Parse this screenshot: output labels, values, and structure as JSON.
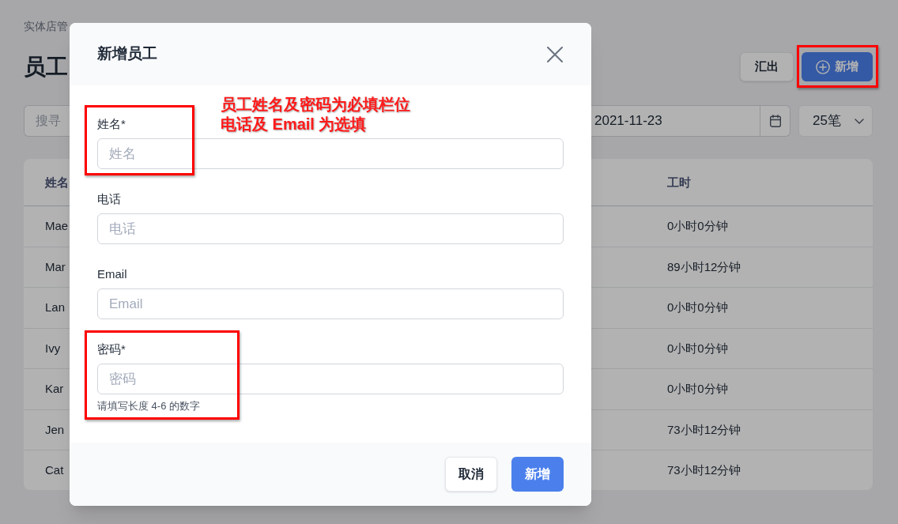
{
  "breadcrumb": [
    "实体店管"
  ],
  "page": {
    "title": "员工",
    "actions": [
      {
        "label": "汇出",
        "kind": "secondary",
        "highlighted": false
      },
      {
        "label": "新增",
        "kind": "primary",
        "highlighted": true
      }
    ]
  },
  "filters": {
    "search": {
      "placeholder": "搜寻"
    },
    "date": {
      "value": "2021-11-23"
    },
    "page_size": {
      "value": "25笔"
    }
  },
  "table": {
    "columns": [
      "姓名",
      "工时"
    ],
    "rows": [
      [
        "Mae",
        "0小时0分钟"
      ],
      [
        "Mar",
        "89小时12分钟"
      ],
      [
        "Lan",
        "0小时0分钟"
      ],
      [
        "Ivy",
        "0小时0分钟"
      ],
      [
        "Kar",
        "0小时0分钟"
      ],
      [
        "Jen",
        "73小时12分钟"
      ],
      [
        "Cat",
        "73小时12分钟"
      ]
    ]
  },
  "dialog": {
    "title": "新增员工",
    "annotation": [
      "员工姓名及密码为必填栏位",
      "电话及 Email 为选填"
    ],
    "fields": [
      {
        "label": "姓名*",
        "placeholder": "姓名",
        "highlighted": true
      },
      {
        "label": "电话",
        "placeholder": "电话",
        "highlighted": false
      },
      {
        "label": "Email",
        "placeholder": "Email",
        "highlighted": false
      },
      {
        "label": "密码*",
        "placeholder": "密码",
        "hint": "请填写长度 4-6 的数字",
        "highlighted": true
      }
    ],
    "buttons": [
      {
        "label": "取消",
        "kind": "secondary"
      },
      {
        "label": "新增",
        "kind": "primary"
      }
    ]
  }
}
